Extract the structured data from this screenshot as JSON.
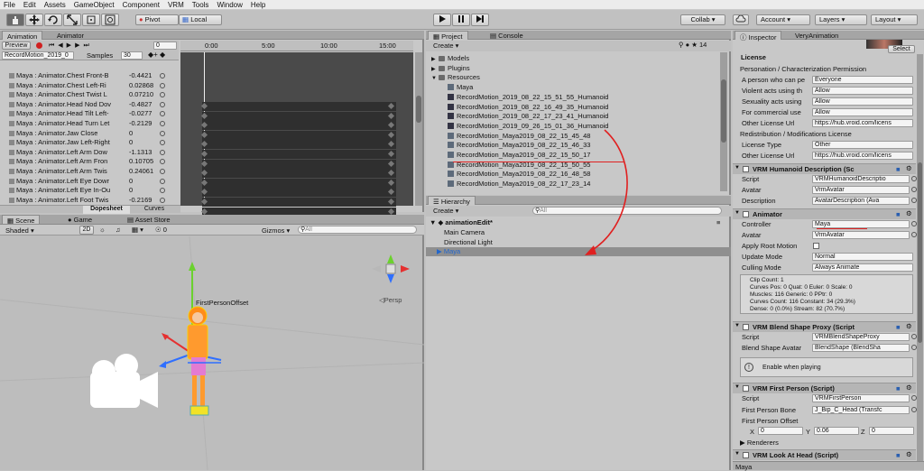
{
  "menu": [
    "File",
    "Edit",
    "Assets",
    "GameObject",
    "Component",
    "VRM",
    "Tools",
    "Window",
    "Help"
  ],
  "toolbar": {
    "pivot": "Pivot",
    "local": "Local",
    "collab": "Collab ▾",
    "account": "Account",
    "layers": "Layers",
    "layout": "Layout"
  },
  "animation": {
    "tabs": [
      "Animation",
      "Animator"
    ],
    "preview": "Preview",
    "frame": "0",
    "clip": "RecordMotion_2019_0",
    "samples_label": "Samples",
    "samples": "30",
    "timeline_ticks": [
      "0:00",
      "5:00",
      "10:00",
      "15:00"
    ],
    "properties": [
      {
        "name": "Maya : Animator.Chest Front-B",
        "value": "-0.4421"
      },
      {
        "name": "Maya : Animator.Chest Left-Ri",
        "value": "0.02868"
      },
      {
        "name": "Maya : Animator.Chest Twist L",
        "value": "0.07210"
      },
      {
        "name": "Maya : Animator.Head Nod Dov",
        "value": "-0.4827"
      },
      {
        "name": "Maya : Animator.Head Tilt Left-",
        "value": "-0.0277"
      },
      {
        "name": "Maya : Animator.Head Turn Let",
        "value": "-0.2129"
      },
      {
        "name": "Maya : Animator.Jaw Close",
        "value": "0"
      },
      {
        "name": "Maya : Animator.Jaw Left-Right",
        "value": "0"
      },
      {
        "name": "Maya : Animator.Left Arm Dow",
        "value": "-1.1313"
      },
      {
        "name": "Maya : Animator.Left Arm Fron",
        "value": "0.10705"
      },
      {
        "name": "Maya : Animator.Left Arm Twis",
        "value": "0.24061"
      },
      {
        "name": "Maya : Animator.Left Eye Dowr",
        "value": "0"
      },
      {
        "name": "Maya : Animator.Left Eye In-Ou",
        "value": "0"
      },
      {
        "name": "Maya : Animator.Left Foot Twis",
        "value": "-0.2169"
      }
    ],
    "dopesheet": "Dopesheet",
    "curves": "Curves"
  },
  "scene": {
    "tabs": [
      "Scene",
      "Game",
      "Asset Store"
    ],
    "shaded": "Shaded",
    "mode2d": "2D",
    "gizmos": "Gizmos ▾",
    "search_placeholder": "All",
    "persp": "◁Persp",
    "label": "FirstPersonOffset"
  },
  "project": {
    "tabs": [
      "Project",
      "Console"
    ],
    "create": "Create ▾",
    "items": [
      {
        "indent": 1,
        "arrow": "▶",
        "type": "folder",
        "label": "Models"
      },
      {
        "indent": 1,
        "arrow": "▶",
        "type": "folder",
        "label": "Plugins"
      },
      {
        "indent": 1,
        "arrow": "▼",
        "type": "folder",
        "label": "Resources"
      },
      {
        "indent": 2,
        "arrow": "",
        "type": "prefab",
        "label": "Maya"
      },
      {
        "indent": 2,
        "arrow": "",
        "type": "anim",
        "label": "RecordMotion_2019_08_22_15_51_55_Humanoid"
      },
      {
        "indent": 2,
        "arrow": "",
        "type": "anim",
        "label": "RecordMotion_2019_08_22_16_49_35_Humanoid"
      },
      {
        "indent": 2,
        "arrow": "",
        "type": "anim",
        "label": "RecordMotion_2019_08_22_17_23_41_Humanoid"
      },
      {
        "indent": 2,
        "arrow": "",
        "type": "anim",
        "label": "RecordMotion_2019_09_26_15_01_36_Humanoid"
      },
      {
        "indent": 2,
        "arrow": "",
        "type": "asset",
        "label": "RecordMotion_Maya2019_08_22_15_45_48"
      },
      {
        "indent": 2,
        "arrow": "",
        "type": "asset",
        "label": "RecordMotion_Maya2019_08_22_15_46_33"
      },
      {
        "indent": 2,
        "arrow": "",
        "type": "asset",
        "label": "RecordMotion_Maya2019_08_22_15_50_17"
      },
      {
        "indent": 2,
        "arrow": "",
        "type": "asset",
        "label": "RecordMotion_Maya2019_08_22_15_50_55"
      },
      {
        "indent": 2,
        "arrow": "",
        "type": "asset",
        "label": "RecordMotion_Maya2019_08_22_16_48_58"
      },
      {
        "indent": 2,
        "arrow": "",
        "type": "asset",
        "label": "RecordMotion_Maya2019_08_22_17_23_14"
      }
    ]
  },
  "hierarchy": {
    "tab": "Hierarchy",
    "create": "Create ▾",
    "search_placeholder": "All",
    "scene": "animationEdit*",
    "items": [
      "Main Camera",
      "Directional Light",
      "Maya"
    ]
  },
  "inspector": {
    "tabs": [
      "Inspector",
      "VeryAnimation"
    ],
    "select": "Select",
    "license": "License",
    "perm_header": "Personation / Characterization Permission",
    "perm_rows": [
      {
        "label": "A person who can pe",
        "value": "Everyone"
      },
      {
        "label": "Violent acts using th",
        "value": "Allow"
      },
      {
        "label": "Sexuality acts using",
        "value": "Allow"
      },
      {
        "label": "For commercial use",
        "value": "Allow"
      },
      {
        "label": "Other License Url",
        "value": "https://hub.vroid.com/licens"
      }
    ],
    "redist_header": "Redistribution / Modifications License",
    "redist_rows": [
      {
        "label": "License Type",
        "value": "Other"
      },
      {
        "label": "Other License Url",
        "value": "https://hub.vroid.com/licens"
      }
    ],
    "humanoid": {
      "title": "VRM Humanoid Description (Sc",
      "script_label": "Script",
      "script": "VRMHumanoidDescriptio",
      "avatar_label": "Avatar",
      "avatar": "VrmAvatar",
      "desc_label": "Description",
      "desc": "AvatarDescription (Ava"
    },
    "animator": {
      "title": "Animator",
      "controller_label": "Controller",
      "controller": "Maya",
      "avatar_label": "Avatar",
      "avatar": "VrmAvatar",
      "root_label": "Apply Root Motion",
      "update_label": "Update Mode",
      "update": "Normal",
      "culling_label": "Culling Mode",
      "culling": "Always Animate",
      "info": [
        "Clip Count: 1",
        "Curves Pos: 0 Quat: 0 Euler: 0 Scale: 0",
        "Muscles: 116 Generic: 0 PPtr: 0",
        "Curves Count: 116 Constant: 34 (29.3%)",
        "Dense: 0 (0.0%) Stream: 82 (70.7%)"
      ]
    },
    "blend": {
      "title": "VRM Blend Shape Proxy (Script",
      "script_label": "Script",
      "script": "VRMBlendShapeProxy",
      "avatar_label": "Blend Shape Avatar",
      "avatar": "BlendShape (BlendSha",
      "note": "Enable when playing"
    },
    "firstperson": {
      "title": "VRM First Person (Script)",
      "script_label": "Script",
      "script": "VRMFirstPerson",
      "bone_label": "First Person Bone",
      "bone": "J_Bip_C_Head (Transfc",
      "offset_label": "First Person Offset",
      "x": "0",
      "y": "0.06",
      "z": "0",
      "renderers": "Renderers"
    },
    "lookat": "VRM Look At Head (Script)",
    "footer": "Maya"
  },
  "colors": {
    "annotation": "#e02020",
    "highlight": "#3d6ca6",
    "scene_bg": "#bdbdbd"
  }
}
